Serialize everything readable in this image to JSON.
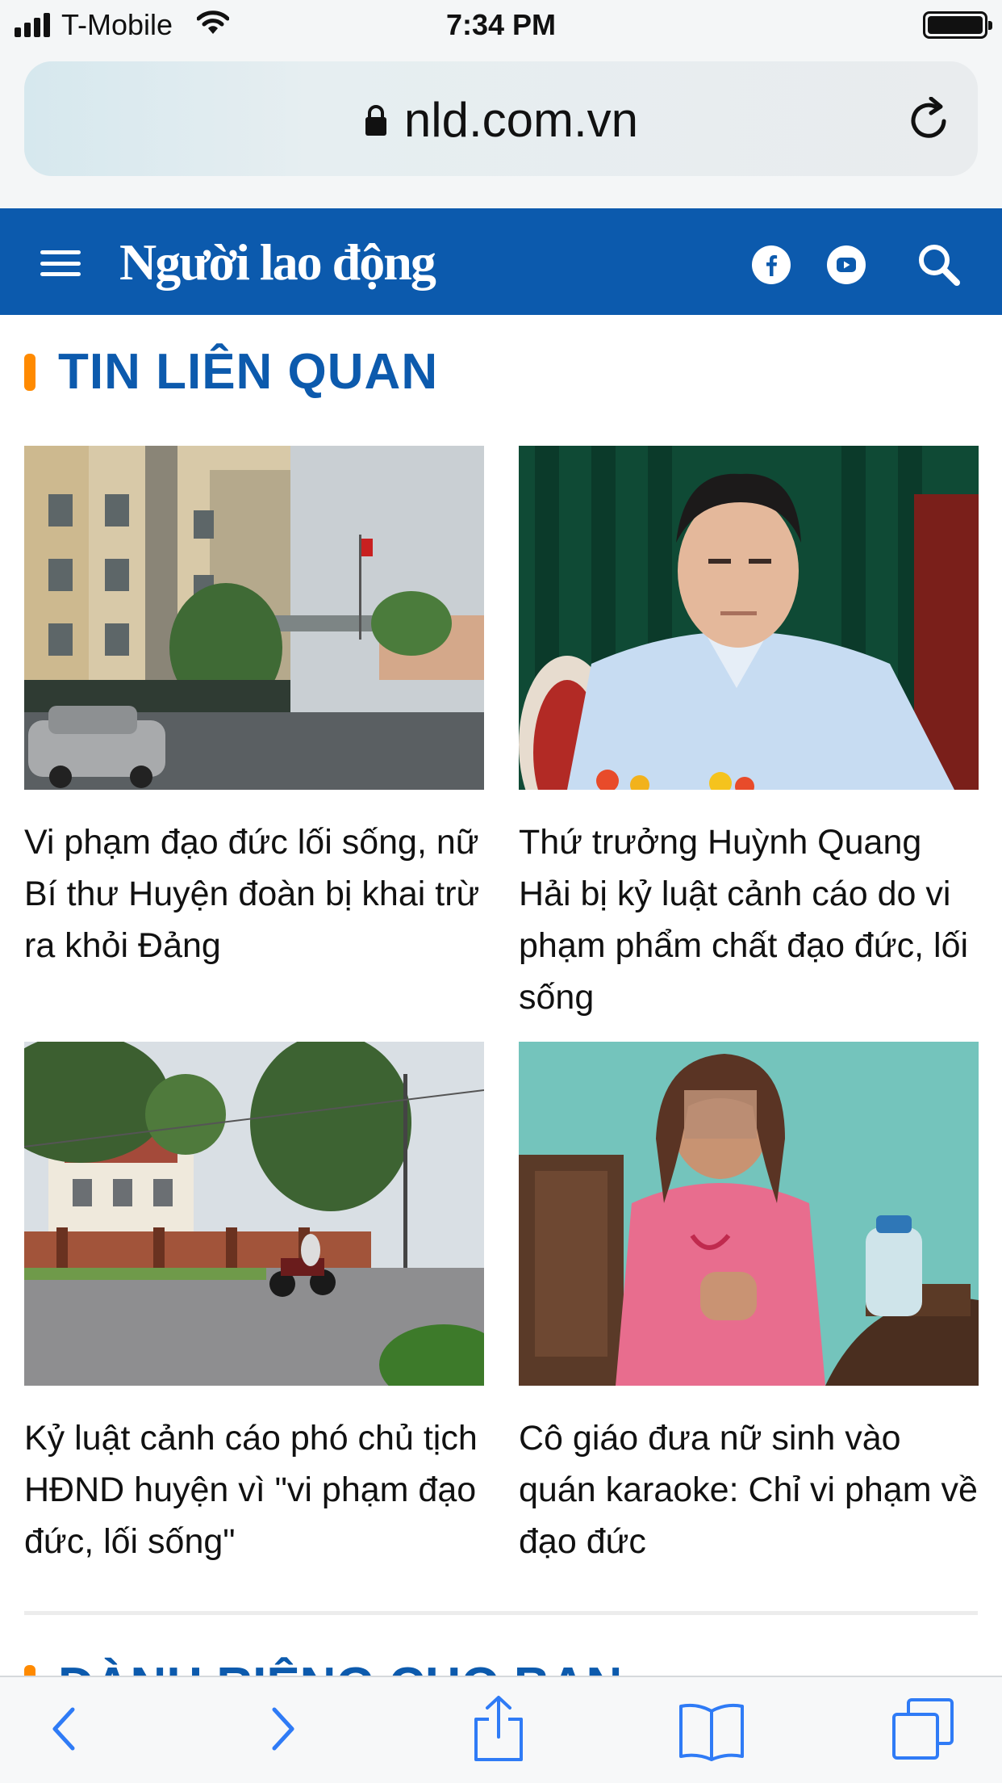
{
  "status_bar": {
    "carrier": "T-Mobile",
    "time": "7:34 PM"
  },
  "browser": {
    "url": "nld.com.vn"
  },
  "site": {
    "logo_text": "Người lao động",
    "brand_color": "#0c5aad",
    "accent_color": "#ff8a00"
  },
  "section": {
    "title": "TIN LIÊN QUAN"
  },
  "articles": [
    {
      "title": "Vi phạm đạo đức lối sống, nữ Bí thư Huyện đoàn bị khai trừ ra khỏi Đảng"
    },
    {
      "title": "Thứ trưởng Huỳnh Quang Hải bị kỷ luật cảnh cáo do vi phạm phẩm chất đạo đức, lối sống"
    },
    {
      "title": "Kỷ luật cảnh cáo phó chủ tịch HĐND huyện vì \"vi phạm đạo đức, lối sống\""
    },
    {
      "title": "Cô giáo đưa nữ sinh vào quán karaoke: Chỉ vi phạm về đạo đức"
    }
  ],
  "next_section": {
    "title": "DÀNH RIÊNG CHO BẠN"
  },
  "icons": {
    "status": [
      "signal-icon",
      "wifi-icon",
      "battery-icon"
    ],
    "header": [
      "menu-icon",
      "facebook-icon",
      "youtube-icon",
      "search-icon"
    ],
    "toolbar": [
      "back-icon",
      "forward-icon",
      "share-icon",
      "bookmarks-icon",
      "tabs-icon"
    ]
  }
}
